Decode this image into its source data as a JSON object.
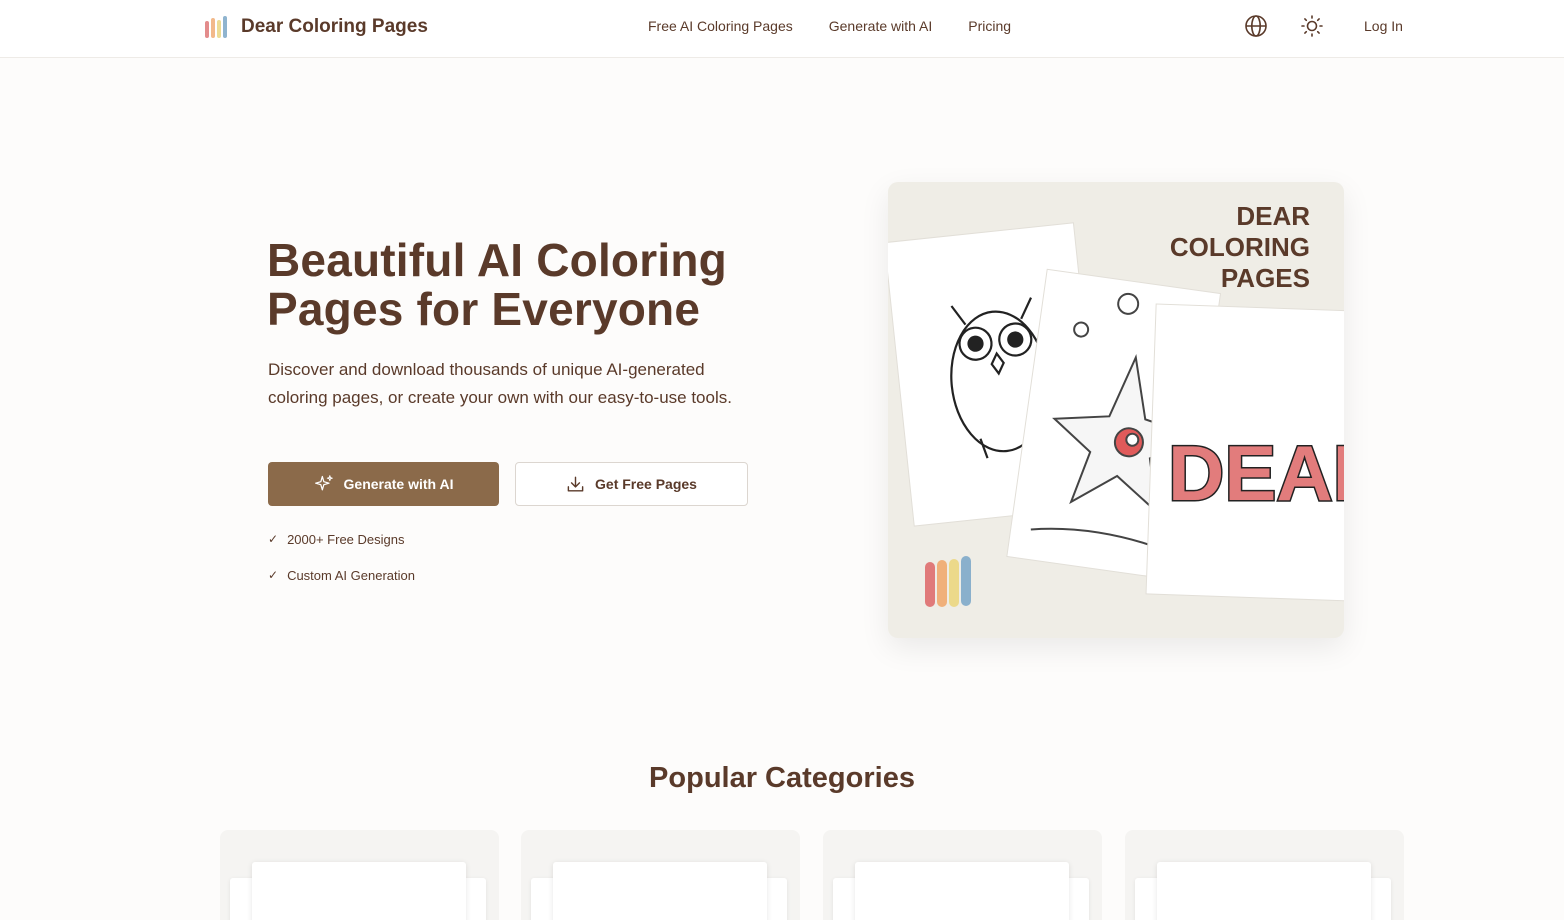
{
  "header": {
    "brand": "Dear Coloring Pages",
    "nav": [
      "Free AI Coloring Pages",
      "Generate with AI",
      "Pricing"
    ],
    "language_icon": "globe-icon",
    "theme_icon": "sun-icon",
    "login_label": "Log In"
  },
  "hero": {
    "title": "Beautiful AI Coloring Pages for Everyone",
    "description": "Discover and download thousands of unique AI-generated coloring pages, or create your own with our easy-to-use tools.",
    "primary_button": "Generate with AI",
    "secondary_button": "Get Free Pages",
    "features": [
      "2000+ Free Designs",
      "Custom AI Generation"
    ],
    "image_text": {
      "line1": "DEAR",
      "line2": "COLORING",
      "line3": "PAGES",
      "big_word": "DEAR"
    }
  },
  "categories": {
    "title": "Popular Categories",
    "count_visible": 4
  },
  "colors": {
    "brown": "#5a3a2a",
    "primary_button": "#8b6a4a",
    "bar_red": "#e07a7a",
    "bar_orange": "#f0b07a",
    "bar_yellow": "#ecd98a",
    "bar_blue": "#8ab0cc"
  }
}
